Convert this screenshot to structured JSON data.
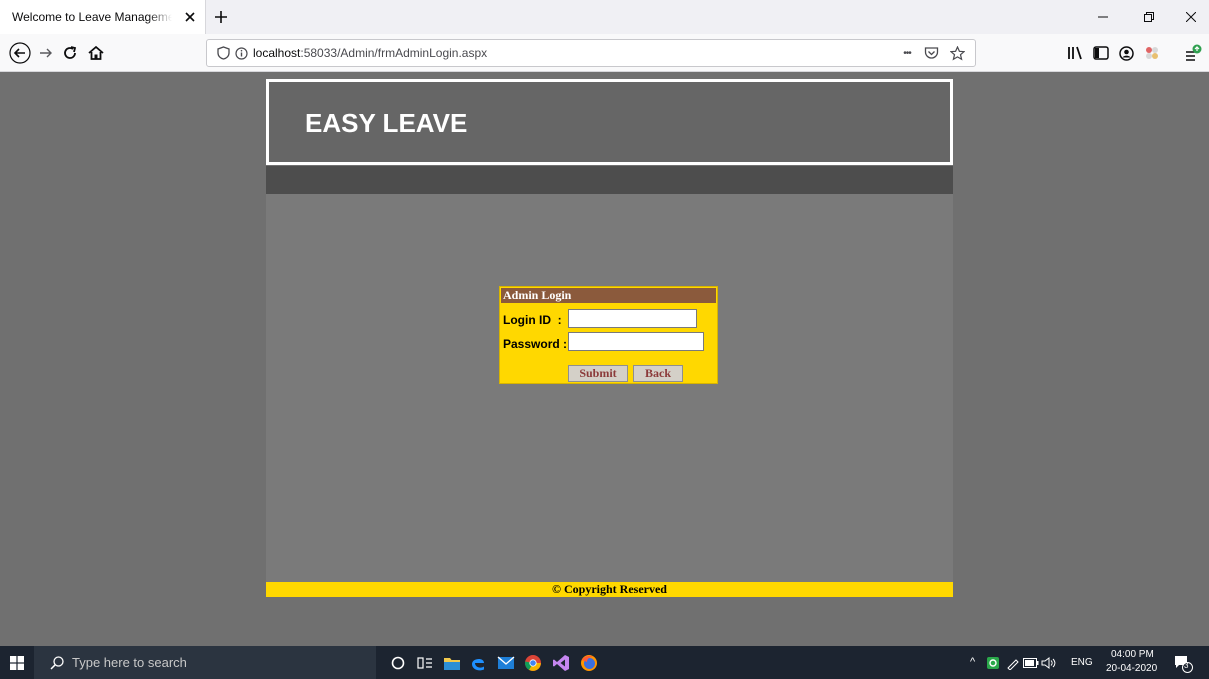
{
  "browser": {
    "tab_title": "Welcome to Leave Management System",
    "url_host": "localhost",
    "url_path": ":58033/Admin/frmAdminLogin.aspx",
    "overflow_menu": "•••"
  },
  "page": {
    "site_title": "EASY LEAVE",
    "login": {
      "heading": "Admin Login",
      "login_id_label": "Login ID  :",
      "password_label": "Password :",
      "login_id_value": "",
      "password_value": "",
      "submit_label": "Submit",
      "back_label": "Back"
    },
    "footer": "© Copyright Reserved"
  },
  "taskbar": {
    "search_placeholder": "Type here to search",
    "language": "ENG",
    "time": "04:00 PM",
    "date": "20-04-2020",
    "notification_count": "3"
  },
  "colors": {
    "page_bg": "#707070",
    "header_bg": "#666666",
    "login_panel": "#ffd800",
    "login_header": "#8b5a3c",
    "footer_bar": "#ffd800"
  }
}
